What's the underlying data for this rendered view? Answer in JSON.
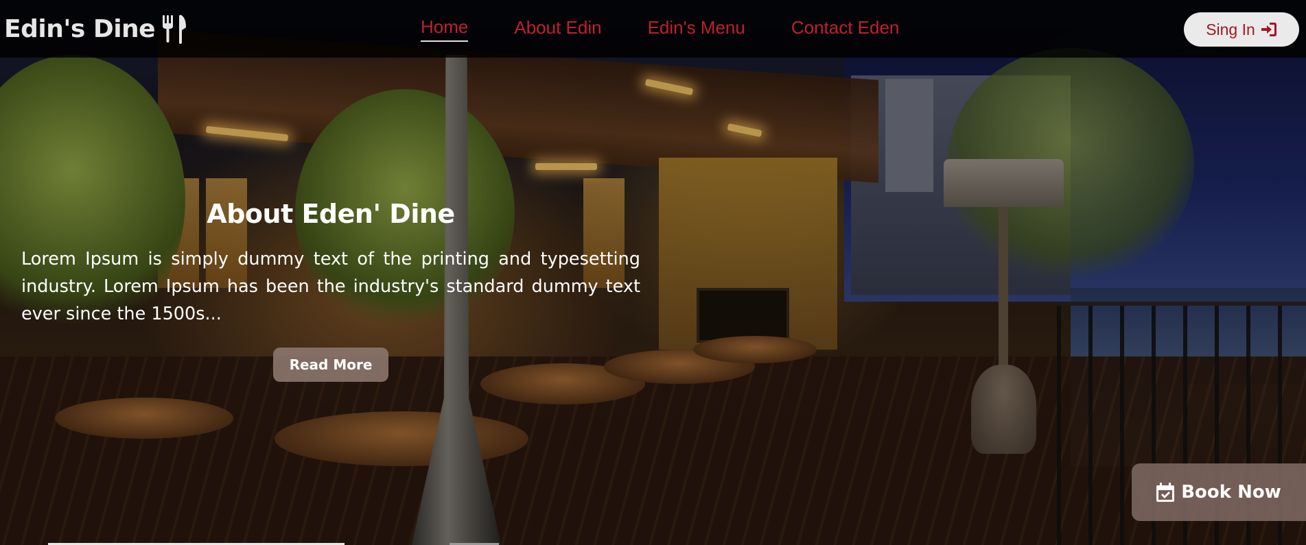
{
  "brand": {
    "name": "Edin's Dine",
    "logo_icon": "utensils-icon"
  },
  "nav": {
    "links": [
      {
        "label": "Home",
        "active": true
      },
      {
        "label": "About Edin",
        "active": false
      },
      {
        "label": "Edin's Menu",
        "active": false
      },
      {
        "label": "Contact Eden",
        "active": false
      }
    ],
    "signin_label": "Sing In",
    "signin_icon": "sign-in-icon"
  },
  "hero": {
    "title": "About Eden' Dine",
    "text": "Lorem Ipsum is simply dummy text of the printing and typesetting industry. Lorem Ipsum has been the industry's standard dummy text ever since the 1500s...",
    "read_more_label": "Read More"
  },
  "book_now": {
    "label": "Book Now",
    "icon": "calendar-check-icon"
  },
  "colors": {
    "accent": "#c0202e",
    "navbar_bg": "#000000",
    "signin_bg": "#eaeaea",
    "button_bg": "#8c766e"
  }
}
